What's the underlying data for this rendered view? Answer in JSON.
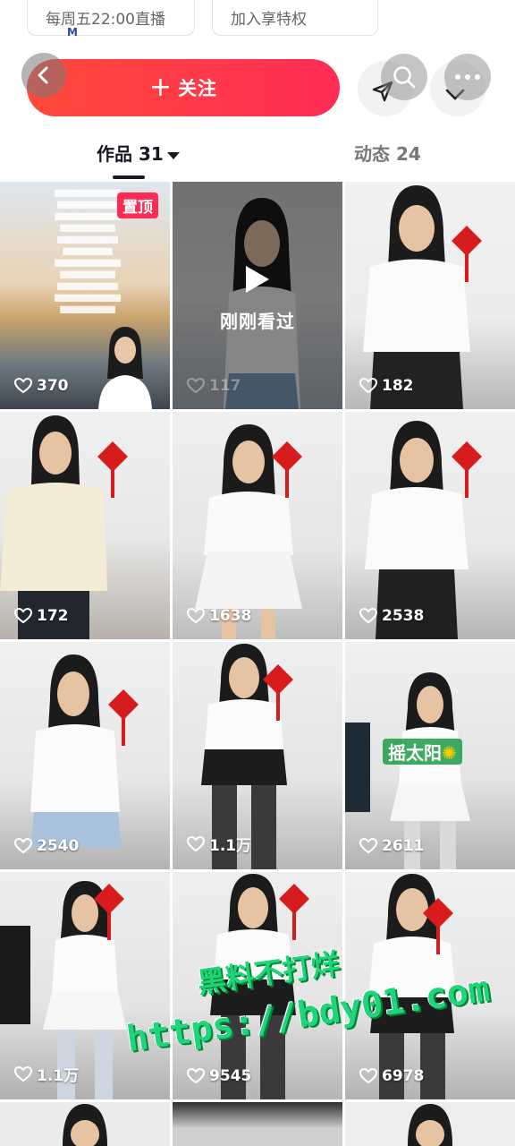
{
  "top_chips": [
    {
      "label": "每周五22:00直播"
    },
    {
      "label": "加入享特权"
    }
  ],
  "actions": {
    "follow_label": "关注",
    "follow_plus": "+"
  },
  "tabs": {
    "works_label": "作品 31",
    "dynamic_label": "动态 24"
  },
  "grid": {
    "pinned_label": "置顶",
    "watched_label": "刚刚看过",
    "sticker_label": "摇太阳",
    "tiles": [
      {
        "likes": "370"
      },
      {
        "likes": "117"
      },
      {
        "likes": "182"
      },
      {
        "likes": "172"
      },
      {
        "likes": "1638"
      },
      {
        "likes": "2538"
      },
      {
        "likes": "2540"
      },
      {
        "likes": "1.1万"
      },
      {
        "likes": "2611"
      },
      {
        "likes": "1.1万"
      },
      {
        "likes": "9545"
      },
      {
        "likes": "6978"
      }
    ]
  },
  "watermark": {
    "line1": "黑料不打烊",
    "line2": "https://bdy01.com"
  },
  "colors": {
    "accent": "#fe2c55",
    "follow_gradient_start": "#ff4a3a",
    "follow_gradient_end": "#ff2c55",
    "watermark": "#1fd47a"
  }
}
